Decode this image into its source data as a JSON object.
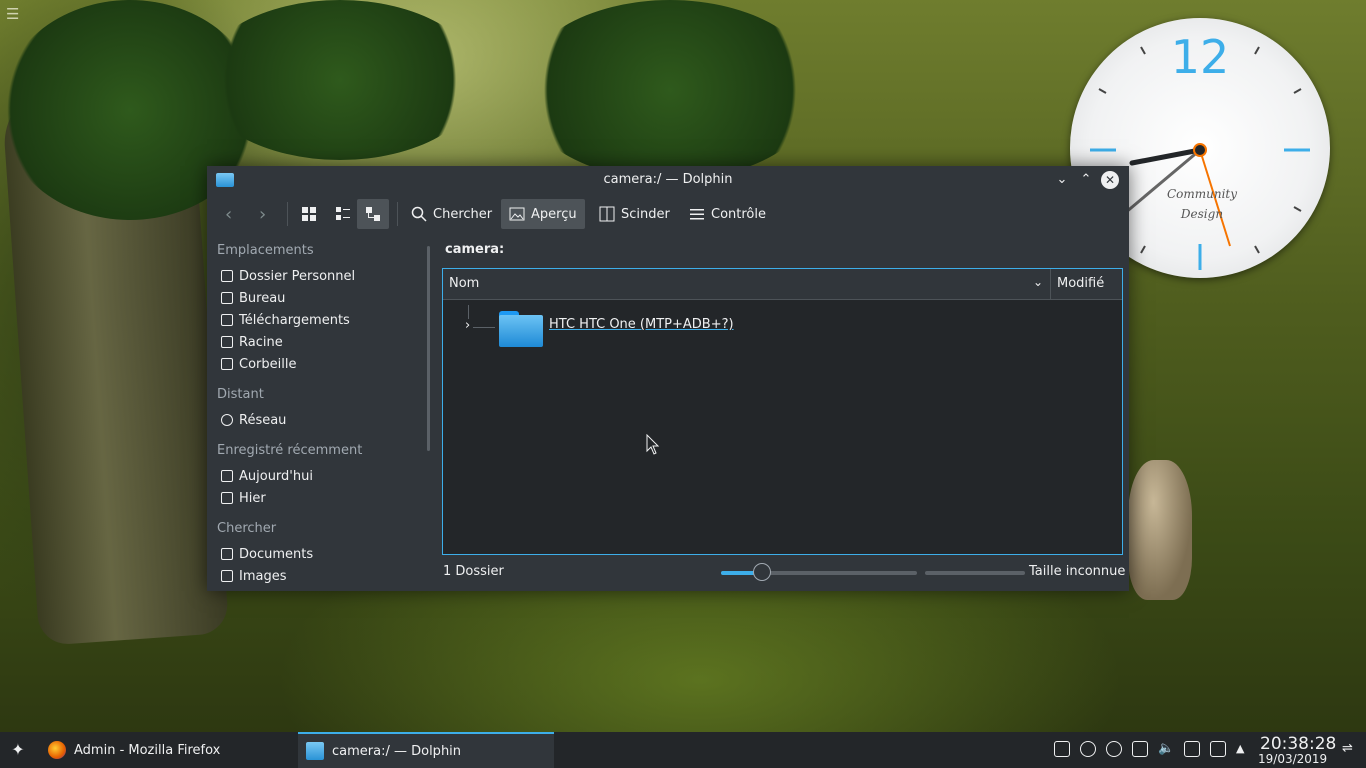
{
  "window": {
    "title": "camera:/ — Dolphin",
    "controls": [
      "minimize",
      "maximize",
      "close"
    ]
  },
  "toolbar": {
    "back_icon": "back-icon",
    "forward_icon": "forward-icon",
    "view_icons": [
      "icons-view-icon",
      "compact-view-icon",
      "details-view-icon"
    ],
    "search_label": "Chercher",
    "preview_label": "Aperçu",
    "split_label": "Scinder",
    "control_label": "Contrôle"
  },
  "sidebar": {
    "places_heading": "Emplacements",
    "places": [
      {
        "label": "Dossier Personnel",
        "icon": "home-icon"
      },
      {
        "label": "Bureau",
        "icon": "desktop-icon"
      },
      {
        "label": "Téléchargements",
        "icon": "download-icon"
      },
      {
        "label": "Racine",
        "icon": "root-icon"
      },
      {
        "label": "Corbeille",
        "icon": "trash-icon"
      }
    ],
    "remote_heading": "Distant",
    "remote": [
      {
        "label": "Réseau",
        "icon": "network-icon"
      }
    ],
    "recent_heading": "Enregistré récemment",
    "recent": [
      {
        "label": "Aujourd'hui",
        "icon": "calendar-icon"
      },
      {
        "label": "Hier",
        "icon": "calendar-icon"
      }
    ],
    "search_heading": "Chercher",
    "search": [
      {
        "label": "Documents",
        "icon": "document-icon"
      },
      {
        "label": "Images",
        "icon": "image-icon"
      }
    ]
  },
  "main": {
    "location": "camera:",
    "columns": {
      "name": "Nom",
      "modified": "Modifié"
    },
    "rows": [
      {
        "name": "HTC HTC One (MTP+ADB+?)",
        "icon": "folder-icon"
      }
    ]
  },
  "statusbar": {
    "summary": "1 Dossier",
    "zoom_fraction": 0.21,
    "space_label": "Taille inconnue"
  },
  "taskbar": {
    "tasks": [
      {
        "label": "Admin - Mozilla Firefox",
        "icon": "firefox-icon"
      },
      {
        "label": "camera:/ — Dolphin",
        "icon": "dolphin-icon"
      }
    ],
    "time": "20:38:28",
    "date": "19/03/2019"
  },
  "desktop_clock": {
    "twelve": "12",
    "brand_line1": "Community",
    "brand_line2": "Design"
  },
  "colors": {
    "accent": "#3daee9",
    "window_bg": "#31363b",
    "view_bg": "#232629"
  }
}
